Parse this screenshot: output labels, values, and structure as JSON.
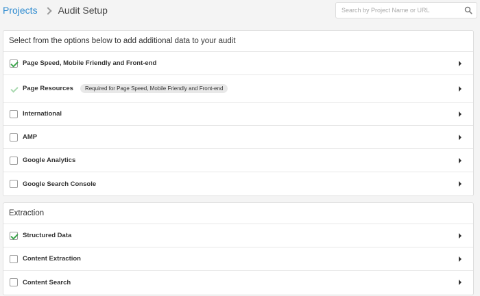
{
  "breadcrumb": {
    "projects": "Projects",
    "current": "Audit Setup"
  },
  "search": {
    "placeholder": "Search by Project Name or URL"
  },
  "panel1": {
    "header": "Select from the options below to add additional data to your audit",
    "items": [
      {
        "label": "Page Speed, Mobile Friendly and Front-end",
        "checked": true
      },
      {
        "label": "Page Resources",
        "checked": true,
        "disabled": true,
        "badge": "Required for Page Speed, Mobile Friendly and Front-end"
      },
      {
        "label": "International",
        "checked": false
      },
      {
        "label": "AMP",
        "checked": false
      },
      {
        "label": "Google Analytics",
        "checked": false
      },
      {
        "label": "Google Search Console",
        "checked": false
      }
    ]
  },
  "panel2": {
    "header": "Extraction",
    "items": [
      {
        "label": "Structured Data",
        "checked": true
      },
      {
        "label": "Content Extraction",
        "checked": false
      },
      {
        "label": "Content Search",
        "checked": false
      }
    ]
  },
  "colors": {
    "link": "#2e8bd0",
    "check": "#3aa54a",
    "check_disabled": "#a9d9b0"
  }
}
